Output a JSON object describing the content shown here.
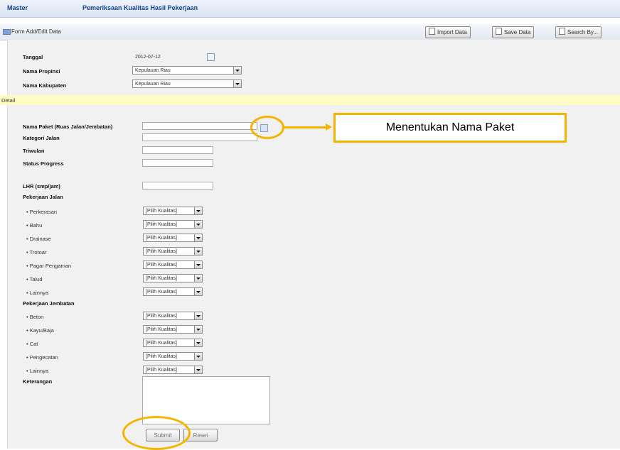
{
  "header": {
    "left": "Master",
    "title": "Pemeriksaan Kualitas Hasil Pekerjaan"
  },
  "form_toolbar": {
    "label": "Form Add/Edit Data",
    "buttons": [
      "Import Data",
      "Save Data",
      "Search By..."
    ]
  },
  "top_fields": {
    "tanggal_label": "Tanggal",
    "tanggal_value": "2012-07-12",
    "propinsi_label": "Nama Propinsi",
    "propinsi_value": "Kepulauan Riau",
    "kabupaten_label": "Nama Kabupaten",
    "kabupaten_value": "Kepulauan Riau"
  },
  "detail": {
    "section_label": "Detail",
    "nama_paket_label": "Nama Paket (Ruas Jalan/Jembatan)",
    "kategori_label": "Kategori Jalan",
    "triwulan_label": "Triwulan",
    "status_label": "Status Progress",
    "lhr_label": "LHR (smp/jam)",
    "pekerjaan_jalan_label": "Pekerjaan Jalan",
    "jalan_items": [
      "Perkerasan",
      "Bahu",
      "Drainase",
      "Trotoar",
      "Pagar Pengaman",
      "Talud",
      "Lainnya"
    ],
    "pekerjaan_jembatan_label": "Pekerjaan Jembatan",
    "jembatan_items": [
      "Beton",
      "Kayu/Baja",
      "Cat",
      "Pengecatan",
      "Lainnya"
    ],
    "select_placeholder": "[Pilih Kualitas]",
    "keterangan_label": "Keterangan"
  },
  "buttons": {
    "submit": "Submit",
    "reset": "Reset"
  },
  "annotation": {
    "callout_text": "Menentukan Nama Paket"
  },
  "colors": {
    "highlight": "#f4b400",
    "header_text": "#15428b",
    "detail_band": "#fdfcc4"
  }
}
